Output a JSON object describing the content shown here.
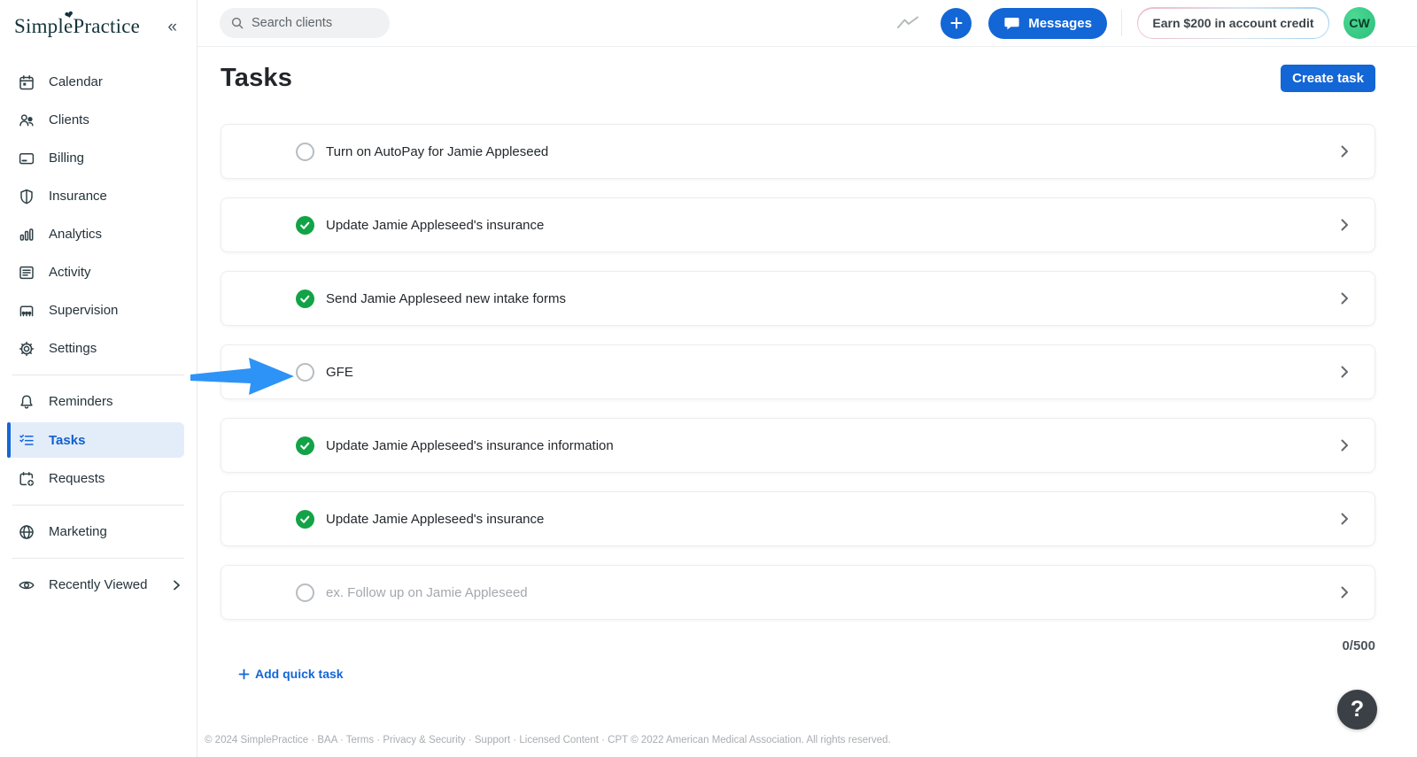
{
  "brand": {
    "name": "SimplePractice",
    "heart": "❤",
    "collapse_icon": "«"
  },
  "sidebar": {
    "items": [
      {
        "label": "Calendar",
        "icon": "calendar-icon"
      },
      {
        "label": "Clients",
        "icon": "clients-icon"
      },
      {
        "label": "Billing",
        "icon": "billing-card-icon"
      },
      {
        "label": "Insurance",
        "icon": "insurance-shield-icon"
      },
      {
        "label": "Analytics",
        "icon": "analytics-bars-icon"
      },
      {
        "label": "Activity",
        "icon": "activity-list-icon"
      },
      {
        "label": "Supervision",
        "icon": "supervision-icon"
      },
      {
        "label": "Settings",
        "icon": "settings-gear-icon"
      },
      {
        "label": "Reminders",
        "icon": "bell-icon"
      },
      {
        "label": "Tasks",
        "icon": "tasks-checklist-icon",
        "active": true
      },
      {
        "label": "Requests",
        "icon": "calendar-plus-icon"
      },
      {
        "label": "Marketing",
        "icon": "globe-icon"
      },
      {
        "label": "Recently Viewed",
        "icon": "eye-icon",
        "trailing_icon": "chevron-right-icon"
      }
    ]
  },
  "header": {
    "search_placeholder": "Search clients",
    "messages_label": "Messages",
    "earn_label": "Earn $200 in account credit",
    "avatar_initials": "CW"
  },
  "page": {
    "title": "Tasks",
    "create_button_label": "Create task"
  },
  "tasks": {
    "items": [
      {
        "state": "open",
        "label": "Turn on AutoPay for Jamie Appleseed"
      },
      {
        "state": "done",
        "label": "Update Jamie Appleseed's insurance"
      },
      {
        "state": "done",
        "label": "Send Jamie Appleseed new intake forms"
      },
      {
        "state": "open",
        "label": "GFE",
        "annotated": true
      },
      {
        "state": "done",
        "label": "Update Jamie Appleseed's insurance information"
      },
      {
        "state": "done",
        "label": "Update Jamie Appleseed's insurance"
      },
      {
        "state": "input",
        "placeholder": "ex. Follow up on Jamie Appleseed"
      }
    ],
    "char_counter": "0/500",
    "add_quick_task_label": "Add quick task"
  },
  "footer": {
    "parts": [
      {
        "label": "© 2024 SimplePractice",
        "link": false
      },
      {
        "label": "BAA",
        "link": true
      },
      {
        "label": "Terms",
        "link": true
      },
      {
        "label": "Privacy & Security",
        "link": true
      },
      {
        "label": "Support",
        "link": true
      },
      {
        "label": "Licensed Content",
        "link": true
      },
      {
        "label": "CPT © 2022 American Medical Association. All rights reserved.",
        "link": false
      }
    ],
    "separator": "·",
    "help_label": "?"
  },
  "colors": {
    "primary_blue": "#1366d6",
    "success_green": "#12a347",
    "annotation_arrow_blue": "#2e93f6",
    "avatar_green": "#2dc07c",
    "active_item_bg": "#e3edfa"
  }
}
